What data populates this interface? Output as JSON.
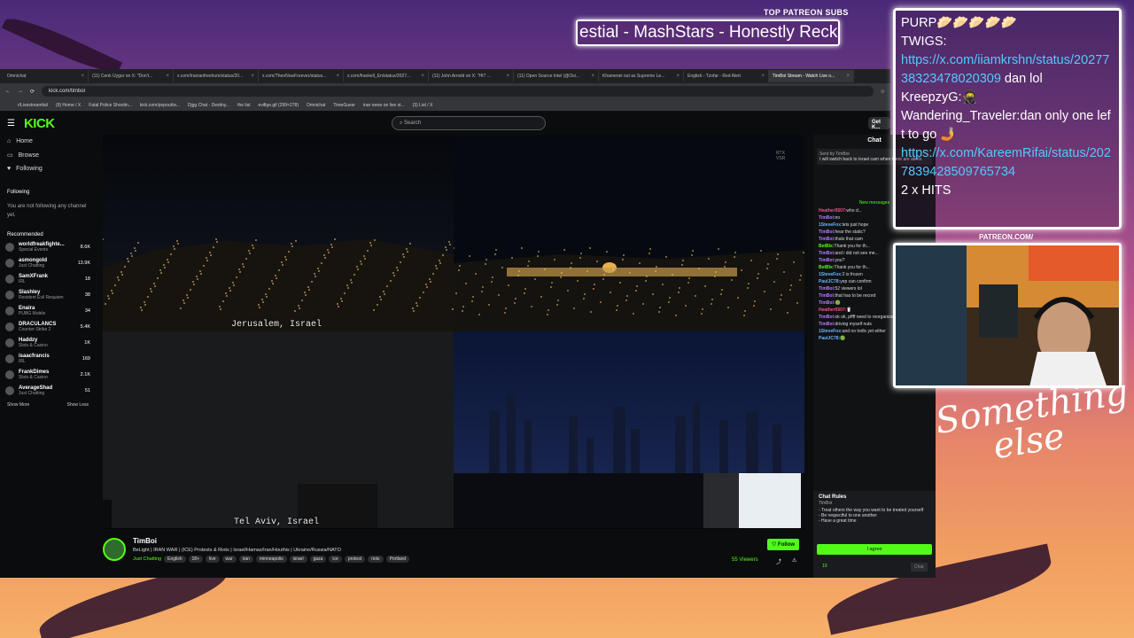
{
  "overlay": {
    "top_patreon_label": "TOP PATREON SUBS",
    "patreon_ticker": "estial - MashStars - Honestly Reckless",
    "patreon_url": "PATREON.COM/",
    "signature": [
      "Something",
      "else"
    ],
    "chat": [
      {
        "user": "PURP",
        "text": "🥟🥟🥟🥟🥟"
      },
      {
        "user": "TWIGS:",
        "text": ""
      },
      {
        "user": "",
        "link": "https://x.com/iiamkrshn/status/2027738323478020309",
        "text": " dan lol"
      },
      {
        "user": "KreepzyG:",
        "text": "🥷"
      },
      {
        "user": "Wandering_Traveler:",
        "text": "dan only one left to go 🤳"
      },
      {
        "user": "",
        "link": "https://x.com/KareemRifai/status/2027839428509765734",
        "text": ""
      },
      {
        "user": "",
        "text": "2 x HITS"
      }
    ]
  },
  "browser": {
    "tabs": [
      "Omnichat",
      "(11) Cenk Uygur on X: \"Don't...",
      "x.com/Iranianfreehum/status/20...",
      "x.com/ThenNowForever/status...",
      "x.com/frankell_En/status/2027...",
      "(11) John Arnold on X: \"HI7 ...",
      "(11) Open Source Intel (@Osi...",
      "Khamenei out as Supreme Le...",
      "English - Tzofar - Red Alert",
      "TimBoi Stream - Watch Live o..."
    ],
    "url": "kick.com/timboi",
    "bookmarks": [
      "r/Livestreamfail",
      "(9) Home / X",
      "Fatal Police Shootin...",
      "kick.com/popout/w...",
      "Djgg Chat - Destiny...",
      "the list",
      "evifige.gif (299×278)",
      "Omnichat",
      "TimeGuesr",
      "iran news on live st...",
      "(3) List / X"
    ]
  },
  "kick": {
    "logo": "KICK",
    "search_placeholder": "Search",
    "go_chat": "Get K...",
    "nav": [
      "Home",
      "Browse",
      "Following"
    ],
    "following_title": "Following",
    "following_empty": "You are not following any channel yet.",
    "recommended_title": "Recommended",
    "recommended": [
      {
        "name": "worldfreakfighte...",
        "cat": "Special Events",
        "viewers": "8.6K"
      },
      {
        "name": "asmongold",
        "cat": "Just Chatting",
        "viewers": "13.9K"
      },
      {
        "name": "SamXFrank",
        "cat": "IRL",
        "viewers": "18"
      },
      {
        "name": "Slashley",
        "cat": "Resident Evil Requiem",
        "viewers": "38"
      },
      {
        "name": "Enaira",
        "cat": "PUBG Mobile",
        "viewers": "34"
      },
      {
        "name": "DRACULANCS",
        "cat": "Counter-Strike 2",
        "viewers": "5.4K"
      },
      {
        "name": "Haddzy",
        "cat": "Slots & Casino",
        "viewers": "1K"
      },
      {
        "name": "isaacfrancis",
        "cat": "IRL",
        "viewers": "169"
      },
      {
        "name": "FrankDimes",
        "cat": "Slots & Casino",
        "viewers": "2.1K"
      },
      {
        "name": "AverageShad",
        "cat": "Just Chatting",
        "viewers": "51"
      }
    ],
    "show_more": "Show More",
    "show_less": "Show Less",
    "cam_labels": [
      "Jerusalem, Israel",
      "Tel Aviv, Israel"
    ],
    "rtx": "RTX\nVSR",
    "streamer": "TimBoi",
    "stream_title": "BeLight | IRAN WAR | (ICE) Protests & Riots |  Israel/Hamas/Iran/Houthis | Ukraine/Russia/NATO",
    "category": "Just Chatting",
    "tags": [
      "English",
      "18+",
      "live",
      "war",
      "iran",
      "minneapolis",
      "israel",
      "gaza",
      "ice",
      "protest",
      "riots",
      "Portland"
    ],
    "follow": "Follow",
    "viewers": "55 Viewers",
    "chat_title": "Chat",
    "pinned": "I will switch back to Israel cam when there are alerts",
    "pinned_by": "Sent by TimBoi",
    "new_messages": "New messages",
    "messages": [
      {
        "u": "Heather5507:",
        "t": "who d...",
        "c": "u3"
      },
      {
        "u": "TimBoi:",
        "t": "no",
        "c": "u1"
      },
      {
        "u": "1SteveFox:",
        "t": "lets just hope",
        "c": "u4"
      },
      {
        "u": "TimBoi:",
        "t": "hear the static?",
        "c": "u1"
      },
      {
        "u": "TimBoi:",
        "t": "thats that cam",
        "c": "u1"
      },
      {
        "u": "BetBlx:",
        "t": "Thank you for th...",
        "c": "u2"
      },
      {
        "u": "TimBoi:",
        "t": "and i did not see me...",
        "c": "u1"
      },
      {
        "u": "TimBoi:",
        "t": "you?",
        "c": "u1"
      },
      {
        "u": "BetBlx:",
        "t": "Thank you for th...",
        "c": "u2"
      },
      {
        "u": "1SteveFox:",
        "t": "2 is frozen",
        "c": "u4"
      },
      {
        "u": "PaulJC78:",
        "t": "yep can confirm",
        "c": "u4"
      },
      {
        "u": "TimBoi:",
        "t": "52 viewers lol",
        "c": "u1"
      },
      {
        "u": "TimBoi:",
        "t": "that has to be record",
        "c": "u1"
      },
      {
        "u": "TimBoi:",
        "t": "🟢",
        "c": "u1"
      },
      {
        "u": "Heather5507:",
        "t": "🥛",
        "c": "u3"
      },
      {
        "u": "TimBoi:",
        "t": "ok ok, pffff need to reorganize anyway",
        "c": "u1"
      },
      {
        "u": "TimBoi:",
        "t": "driving myself nuts",
        "c": "u1"
      },
      {
        "u": "1SteveFox:",
        "t": "and no trolls yet either",
        "c": "u4"
      },
      {
        "u": "PaulJC78:",
        "t": "🟢",
        "c": "u4"
      }
    ],
    "rules_title": "Chat Rules",
    "rules_by": "TimBoi",
    "rules": [
      "- Treat others the way you want to be treated yourself",
      "- Be respectful to one another",
      "- Have a great time"
    ],
    "agree": "I agree",
    "points": "10",
    "chat_button": "Chat"
  }
}
